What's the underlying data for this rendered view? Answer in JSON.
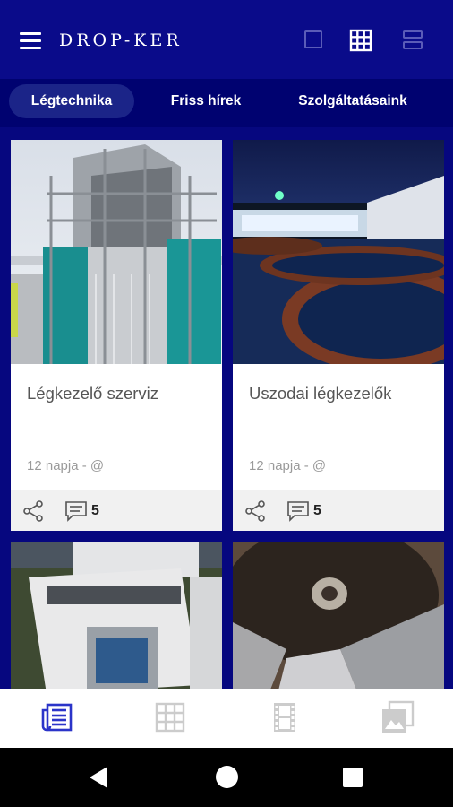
{
  "app": {
    "brand": "DROP-KER"
  },
  "icons": {
    "menu": "hamburger-menu-icon",
    "view_single": "single-view-icon",
    "view_grid": "grid-view-icon",
    "view_list": "list-view-icon",
    "share": "share-icon",
    "comment": "comment-icon",
    "nav_news": "news-icon",
    "nav_grid": "grid-icon",
    "nav_video": "film-icon",
    "nav_gallery": "gallery-icon"
  },
  "colors": {
    "primary": "#0a0b8a",
    "background": "#06077f",
    "tabs_background": "#000270",
    "active_tab": "#1b2488",
    "active_nav_icon": "#2b34c9",
    "inactive_icon": "#cccccc"
  },
  "tabs": [
    {
      "label": "Légtechnika",
      "active": true
    },
    {
      "label": "Friss hírek",
      "active": false
    },
    {
      "label": "Szolgáltatásaink",
      "active": false
    }
  ],
  "cards": [
    {
      "title": "Légkezelő szerviz",
      "meta": "12 napja - @",
      "comments": "5"
    },
    {
      "title": "Uszodai légkezelők",
      "meta": "12 napja - @",
      "comments": "5"
    }
  ]
}
